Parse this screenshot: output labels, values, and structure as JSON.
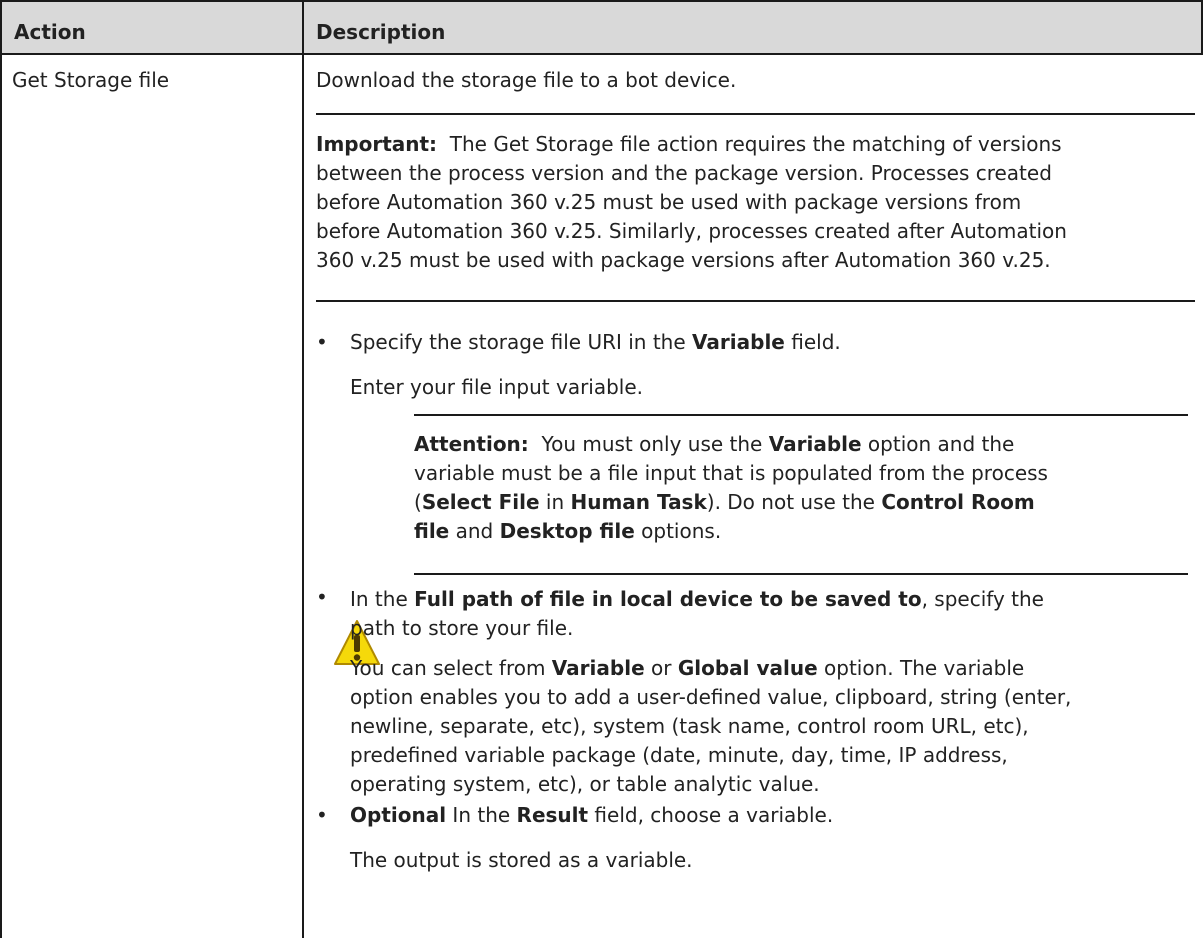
{
  "table": {
    "header": {
      "action": "Action",
      "description": "Description"
    },
    "row": {
      "action": "Get Storage file",
      "intro": "Download the storage file to a bot device.",
      "important": {
        "label": "Important:",
        "lines": [
          "The Get Storage file action requires the matching of versions",
          "between the process version and the package version. Processes created",
          "before Automation 360 v.25 must be used with package versions from",
          "before Automation 360 v.25. Similarly, processes created after Automation",
          "360 v.25 must be used with package versions after Automation 360 v.25."
        ]
      },
      "bullet1": {
        "pre": "Specify the storage file URI in the ",
        "bold": "Variable",
        "post": " field.",
        "sub": "Enter your file input variable."
      },
      "attention": {
        "label": "Attention:",
        "l1_pre": "You must only use the ",
        "l1_bold": "Variable",
        "l1_post": " option and the",
        "l2": "variable must be a file input that is populated from the process",
        "l3_open": "(",
        "l3_b1": "Select File",
        "l3_mid": " in ",
        "l3_b2": "Human Task",
        "l3_post": "). Do not use the ",
        "l3_b3": "Control Room",
        "l4_b1": "file",
        "l4_mid": " and ",
        "l4_b2": "Desktop file",
        "l4_post": " options."
      },
      "bullet2": {
        "pre": "In the ",
        "bold": "Full path of file in local device to be saved to",
        "post": ", specify the",
        "line2": "path to store your file.",
        "sub_pre": "You can select from ",
        "sub_b1": "Variable",
        "sub_mid": " or ",
        "sub_b2": "Global value",
        "sub_post": " option. The variable",
        "sub_lines": [
          "option enables you to add a user-defined value, clipboard, string (enter,",
          "newline, separate, etc), system (task name, control room URL, etc),",
          "predefined variable package (date, minute, day, time, IP address,",
          "operating system, etc), or table analytic value."
        ]
      },
      "bullet3": {
        "bold1": "Optional",
        "mid": " In the ",
        "bold2": "Result",
        "post": " field, choose a variable.",
        "sub": "The output is stored as a variable."
      }
    },
    "colors": {
      "header_bg": "#d9d9d9",
      "border": "#1a1a1a",
      "warning_yellow": "#f5d90a"
    },
    "icons": {
      "attention": "warning-triangle-icon"
    }
  }
}
